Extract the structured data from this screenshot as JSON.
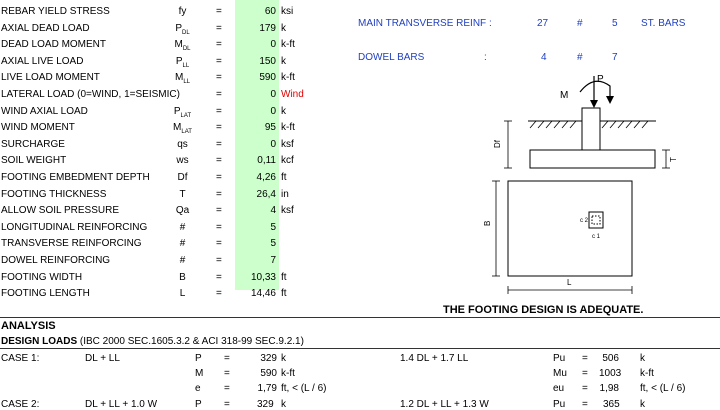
{
  "inputs": [
    {
      "label": "REBAR YIELD STRESS",
      "sym": "fy",
      "sub": "",
      "val": "60",
      "unit": "ksi",
      "unit_color": "#000000"
    },
    {
      "label": "AXIAL DEAD LOAD",
      "sym": "P",
      "sub": "DL",
      "val": "179",
      "unit": "k",
      "unit_color": "#000000"
    },
    {
      "label": "DEAD LOAD MOMENT",
      "sym": "M",
      "sub": "DL",
      "val": "0",
      "unit": "k-ft",
      "unit_color": "#000000"
    },
    {
      "label": "AXIAL LIVE LOAD",
      "sym": "P",
      "sub": "LL",
      "val": "150",
      "unit": "k",
      "unit_color": "#000000"
    },
    {
      "label": "LIVE LOAD MOMENT",
      "sym": "M",
      "sub": "LL",
      "val": "590",
      "unit": "k-ft",
      "unit_color": "#000000"
    },
    {
      "label": "LATERAL LOAD (0=WIND, 1=SEISMIC)",
      "sym": "",
      "sub": "",
      "val": "0",
      "unit": "Wind",
      "unit_color": "#e00000"
    },
    {
      "label": "WIND AXIAL LOAD",
      "sym": "P",
      "sub": "LAT",
      "val": "0",
      "unit": "k",
      "unit_color": "#000000"
    },
    {
      "label": "WIND MOMENT",
      "sym": "M",
      "sub": "LAT",
      "val": "95",
      "unit": "k-ft",
      "unit_color": "#000000"
    },
    {
      "label": "SURCHARGE",
      "sym": "qs",
      "sub": "",
      "val": "0",
      "unit": "ksf",
      "unit_color": "#000000"
    },
    {
      "label": "SOIL WEIGHT",
      "sym": "ws",
      "sub": "",
      "val": "0,11",
      "unit": "kcf",
      "unit_color": "#000000"
    },
    {
      "label": "FOOTING EMBEDMENT DEPTH",
      "sym": "Df",
      "sub": "",
      "val": "4,26",
      "unit": "ft",
      "unit_color": "#000000"
    },
    {
      "label": "FOOTING THICKNESS",
      "sym": "T",
      "sub": "",
      "val": "26,4",
      "unit": "in",
      "unit_color": "#000000"
    },
    {
      "label": "ALLOW SOIL PRESSURE",
      "sym": "Qa",
      "sub": "",
      "val": "4",
      "unit": "ksf",
      "unit_color": "#000000"
    },
    {
      "label": "LONGITUDINAL REINFORCING",
      "sym": "#",
      "sub": "",
      "val": "5",
      "unit": "",
      "unit_color": "#000000"
    },
    {
      "label": "TRANSVERSE REINFORCING",
      "sym": "#",
      "sub": "",
      "val": "5",
      "unit": "",
      "unit_color": "#000000"
    },
    {
      "label": "DOWEL REINFORCING",
      "sym": "#",
      "sub": "",
      "val": "7",
      "unit": "",
      "unit_color": "#000000"
    },
    {
      "label": "FOOTING WIDTH",
      "sym": "B",
      "sub": "",
      "val": "10,33",
      "unit": "ft",
      "unit_color": "#000000"
    },
    {
      "label": "FOOTING LENGTH",
      "sym": "L",
      "sub": "",
      "val": "14,46",
      "unit": "ft",
      "unit_color": "#000000"
    }
  ],
  "reinforcement": [
    {
      "label": "MAIN TRANSVERSE REINF :",
      "count": "27",
      "hash": "#",
      "size": "5",
      "note": "ST. BARS"
    },
    {
      "label": "DOWEL BARS",
      "colon": ":",
      "count": "4",
      "hash": "#",
      "size": "7",
      "note": ""
    }
  ],
  "diagram": {
    "p": "P",
    "m": "M",
    "df": "Df",
    "t": "T",
    "b": "B",
    "l": "L",
    "c1": "c 1",
    "c2": "c 2"
  },
  "adequacy": "THE FOOTING DESIGN IS ADEQUATE.",
  "analysis": {
    "title": "ANALYSIS",
    "design_loads_bold": "DESIGN  LOADS",
    "design_loads_ref": "(IBC 2000 SEC.1605.3.2 & ACI 318-99 SEC.9.2.1)",
    "case_label": "CASE 1:",
    "case_combo": "DL + LL",
    "rows": [
      {
        "sym": "P",
        "eq": "=",
        "val": "329",
        "unit": "k",
        "combo": "1.4 DL + 1.7 LL",
        "usym": "Pu",
        "ueq": "=",
        "uval": "506",
        "uunit": "k"
      },
      {
        "sym": "M",
        "eq": "=",
        "val": "590",
        "unit": "k-ft",
        "combo": "",
        "usym": "Mu",
        "ueq": "=",
        "uval": "1003",
        "uunit": "k-ft"
      },
      {
        "sym": "e",
        "eq": "=",
        "val": "1,79",
        "unit": "ft, < (L / 6)",
        "combo": "",
        "usym": "eu",
        "ueq": "=",
        "uval": "1,98",
        "uunit": "ft, < (L / 6)"
      }
    ],
    "case2": {
      "label": "CASE 2:",
      "combo": "DL + LL + 1.0 W",
      "sym": "P",
      "eq": "=",
      "val": "329",
      "unit": "k",
      "combo2": "1.2 DL + LL + 1.3 W",
      "usym": "Pu",
      "ueq": "=",
      "uval": "365",
      "uunit": "k"
    }
  }
}
